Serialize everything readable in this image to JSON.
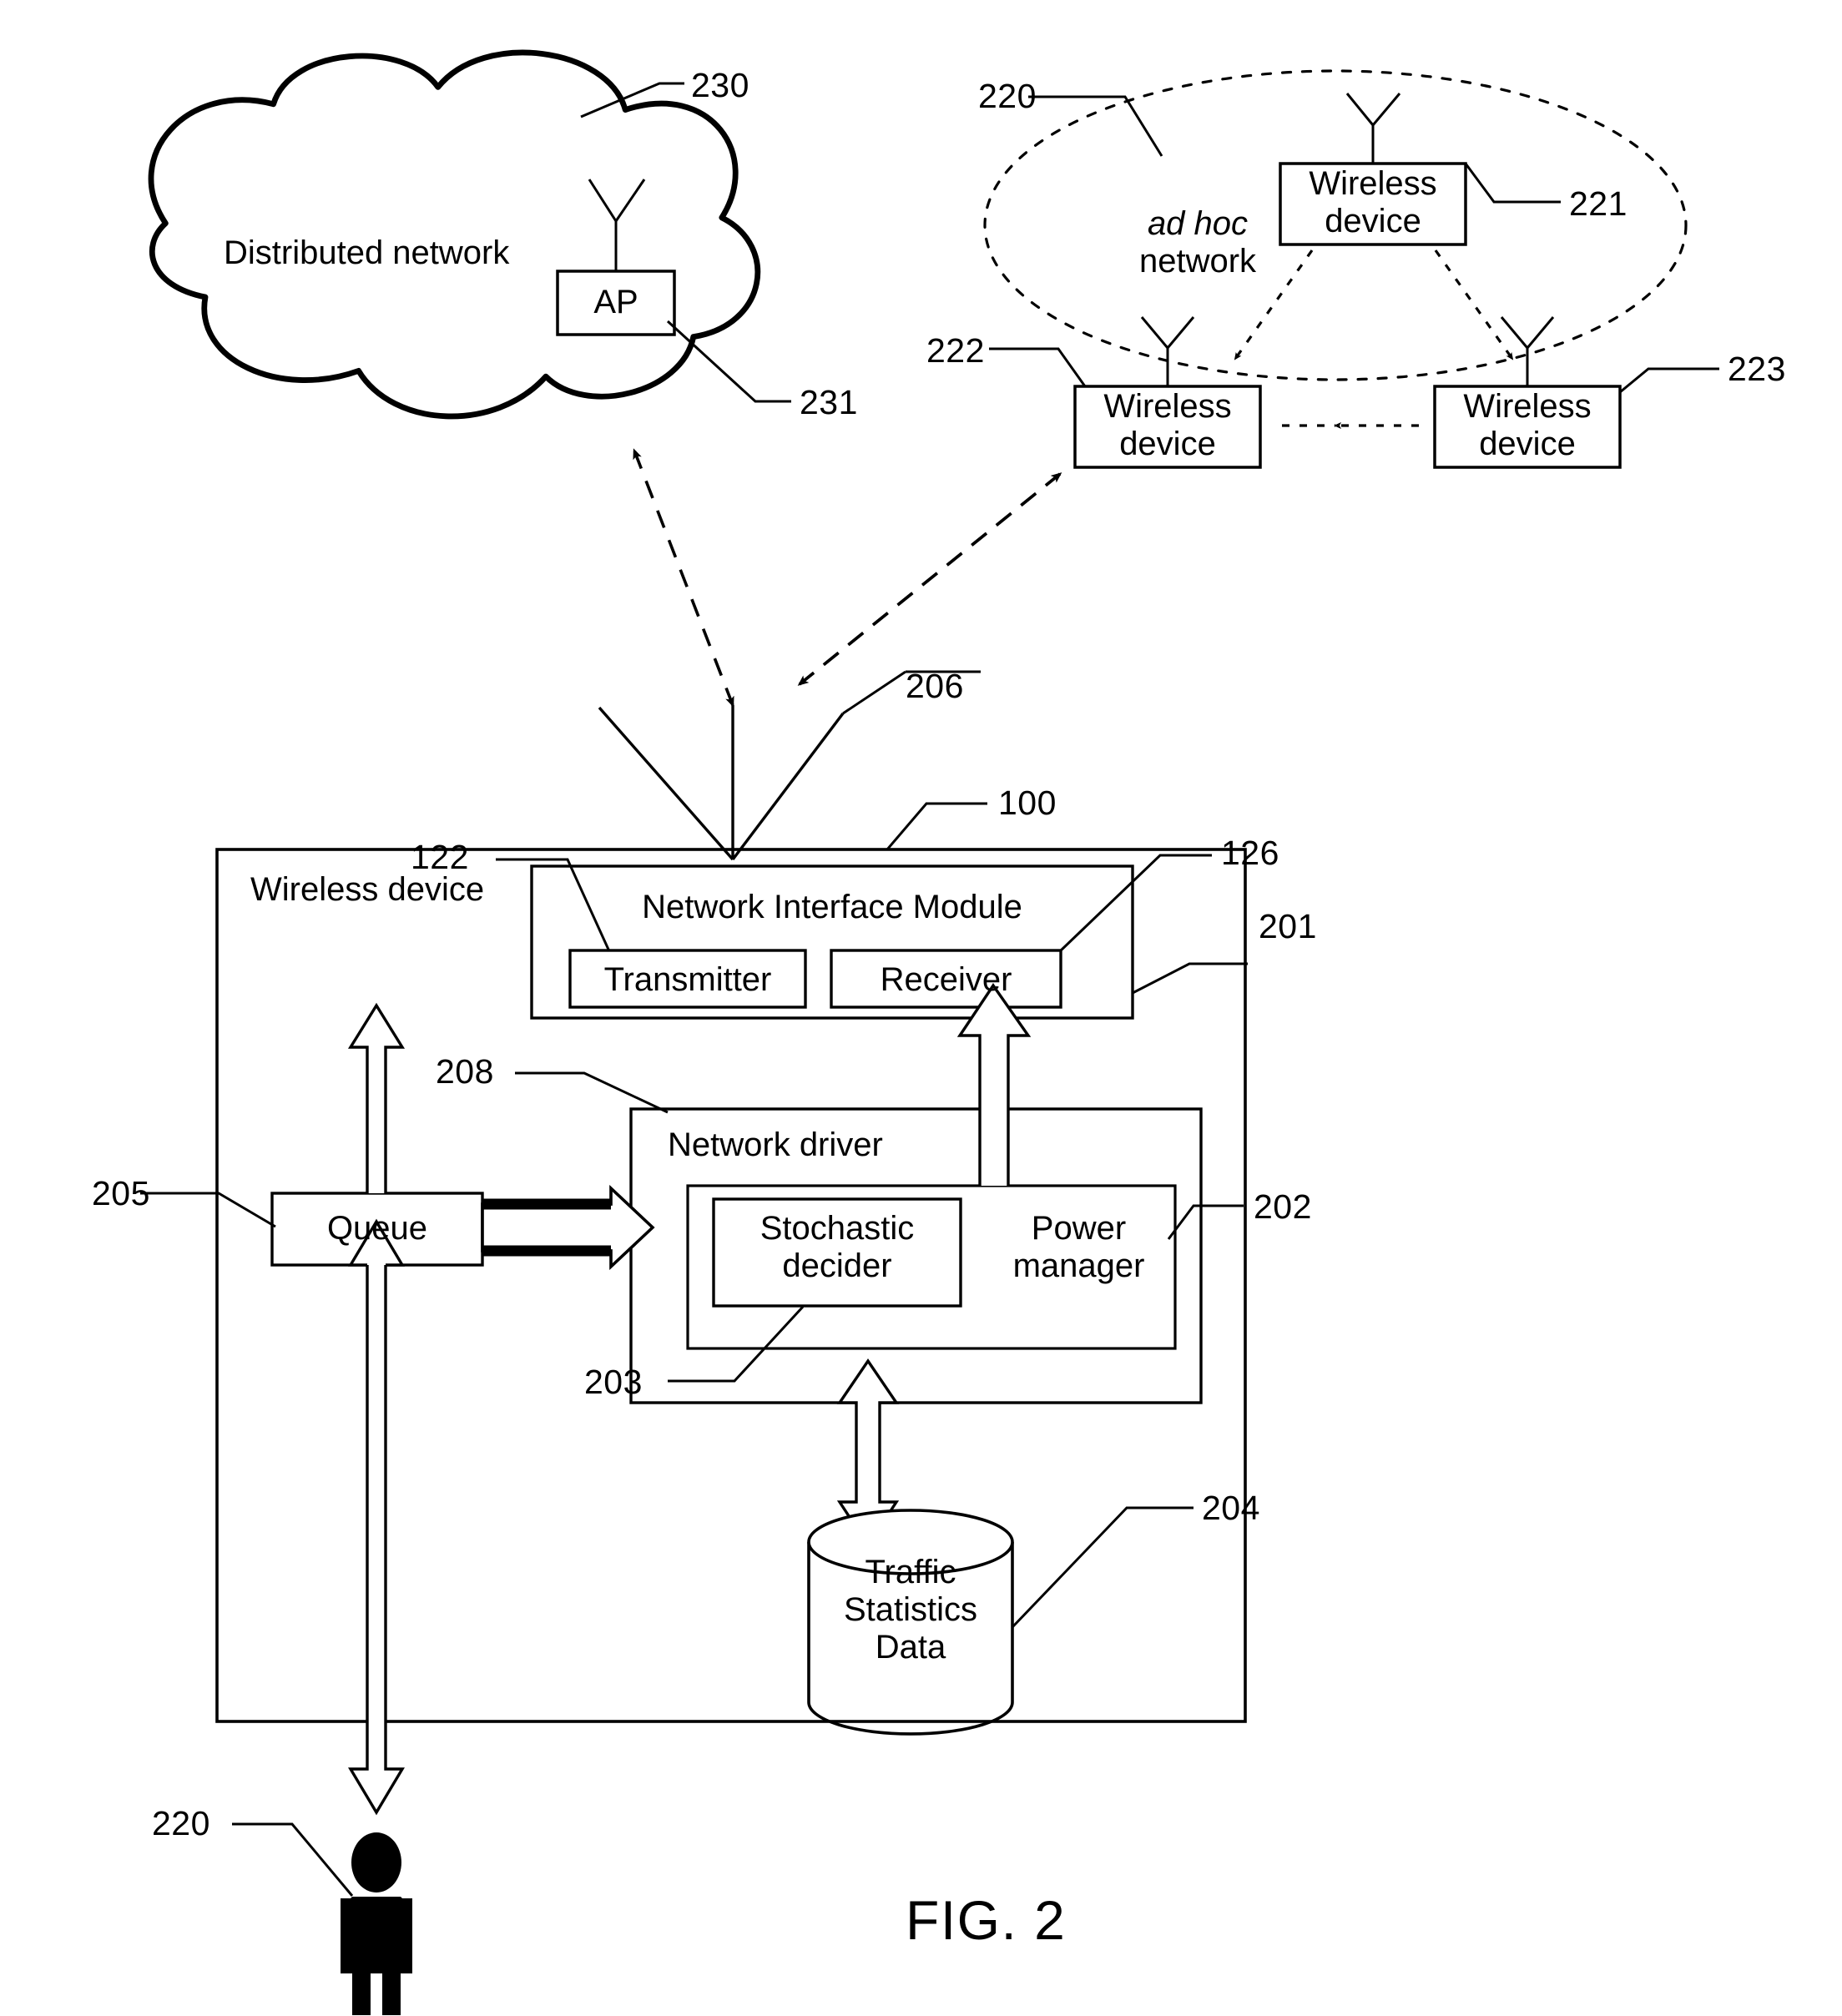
{
  "figure": {
    "title": "FIG. 2",
    "cloud": {
      "label": "Distributed network",
      "ref": "230",
      "ap": {
        "label": "AP",
        "ref": "231"
      }
    },
    "adhoc": {
      "label_italic": "ad hoc",
      "label_plain": "network",
      "ref": "220",
      "devices": [
        {
          "label_line1": "Wireless",
          "label_line2": "device",
          "ref": "221"
        },
        {
          "label_line1": "Wireless",
          "label_line2": "device",
          "ref": "222"
        },
        {
          "label_line1": "Wireless",
          "label_line2": "device",
          "ref": "223"
        }
      ]
    },
    "link_ref": "206",
    "device": {
      "label": "Wireless device",
      "ref": "100",
      "nim": {
        "label": "Network Interface Module",
        "ref": "201",
        "transmitter": {
          "label": "Transmitter",
          "ref": "122"
        },
        "receiver": {
          "label": "Receiver",
          "ref": "126"
        }
      },
      "driver": {
        "label": "Network driver",
        "ref": "208",
        "power_manager": {
          "label_line1": "Power",
          "label_line2": "manager",
          "ref": "202"
        },
        "stochastic_decider": {
          "label_line1": "Stochastic",
          "label_line2": "decider",
          "ref": "203"
        }
      },
      "queue": {
        "label": "Queue",
        "ref": "205"
      },
      "traffic_db": {
        "label_line1": "Traffic",
        "label_line2": "Statistics",
        "label_line3": "Data",
        "ref": "204"
      },
      "user": {
        "ref": "220"
      }
    }
  }
}
